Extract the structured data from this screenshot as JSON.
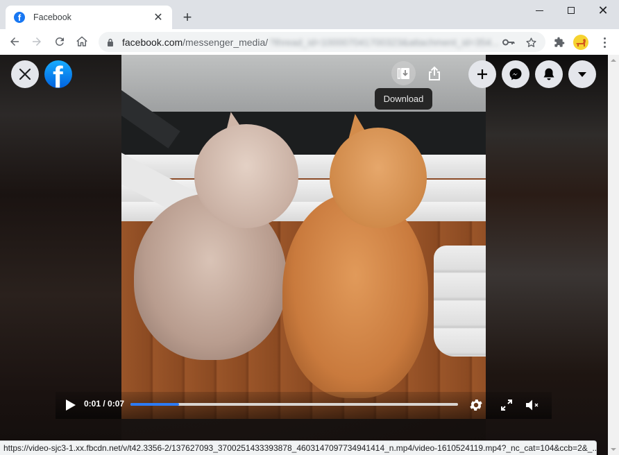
{
  "browser": {
    "tab": {
      "title": "Facebook",
      "favicon": "facebook-favicon"
    },
    "new_tab_icon": "+",
    "window_controls": {
      "minimize": "minimize-icon",
      "maximize": "maximize-icon",
      "close": "close-icon"
    },
    "url": {
      "host": "facebook.com",
      "path": "/messenger_media/",
      "blurred_tail": "?thread_id=100007041700323&attachment_id=354..."
    },
    "toolbar_icons": [
      "back-icon",
      "forward-icon",
      "reload-icon",
      "home-icon",
      "lock-icon",
      "key-icon",
      "star-icon",
      "extensions-icon",
      "profile-avatar",
      "menu-icon"
    ]
  },
  "viewer": {
    "close_label": "Close",
    "logo_letter": "f",
    "download_tooltip": "Download",
    "actions": [
      "download-icon",
      "share-icon"
    ],
    "header_buttons": [
      "create-icon",
      "messenger-icon",
      "notifications-icon",
      "account-menu-icon"
    ]
  },
  "player": {
    "current_time": "0:01",
    "duration": "0:07",
    "time_display": "0:01 / 0:07",
    "progress_fraction": 0.148,
    "muted": true,
    "accent_color": "#2d7bf4",
    "icons": [
      "play-icon",
      "settings-icon",
      "fullscreen-icon",
      "volume-muted-icon"
    ]
  },
  "status_url": "https://video-sjc3-1.xx.fbcdn.net/v/t42.3356-2/137627093_3700251433393878_4603147097734941414_n.mp4/video-1610524119.mp4?_nc_cat=104&ccb=2&_..."
}
